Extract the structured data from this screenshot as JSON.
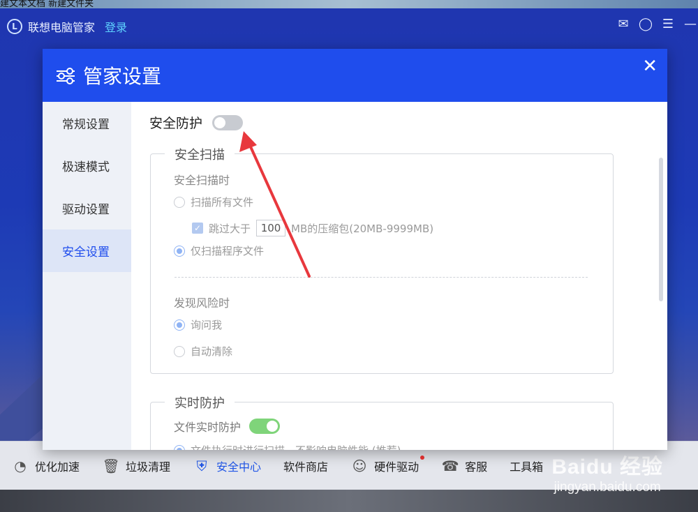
{
  "desktop": {
    "top_text": "建文本文档  新建文件夹"
  },
  "app": {
    "name": "联想电脑管家",
    "login": "登录"
  },
  "window_icons": [
    "feedback-icon",
    "skin-icon",
    "menu-icon",
    "minimize-icon"
  ],
  "taskbar": [
    {
      "label": "优化加速",
      "icon": "speedometer-icon"
    },
    {
      "label": "垃圾清理",
      "icon": "trash-icon"
    },
    {
      "label": "安全中心",
      "icon": "shield-icon",
      "active": true
    },
    {
      "label": "软件商店",
      "icon": "store-icon"
    },
    {
      "label": "硬件驱动",
      "icon": "hardware-icon",
      "badge": true
    },
    {
      "label": "客服",
      "icon": "headset-icon"
    },
    {
      "label": "工具箱",
      "icon": "toolbox-icon"
    }
  ],
  "watermark": {
    "line1": "Baidu 经验",
    "line2": "jingyan.baidu.com"
  },
  "dialog": {
    "title": "管家设置",
    "sidebar": [
      {
        "label": "常规设置"
      },
      {
        "label": "极速模式"
      },
      {
        "label": "驱动设置"
      },
      {
        "label": "安全设置",
        "active": true
      }
    ],
    "security": {
      "label": "安全防护",
      "enabled": false,
      "scan": {
        "title": "安全扫描",
        "when_label": "安全扫描时",
        "opt_all": "扫描所有文件",
        "skip_prefix": "跳过大于",
        "skip_value": "100",
        "skip_suffix": "MB的压缩包(20MB-9999MB)",
        "opt_program": "仅扫描程序文件",
        "risk_label": "发现风险时",
        "opt_ask": "询问我",
        "opt_auto": "自动清除"
      },
      "realtime": {
        "title": "实时防护",
        "file_label": "文件实时防护",
        "file_enabled": true,
        "opt_exec": "文件执行时进行扫描，不影响电脑性能 (推荐)"
      }
    }
  },
  "colors": {
    "accent": "#1f4ded",
    "arrow": "#e8383d",
    "toggle_on": "#7fd47a",
    "toggle_off": "#c8cbd1"
  }
}
